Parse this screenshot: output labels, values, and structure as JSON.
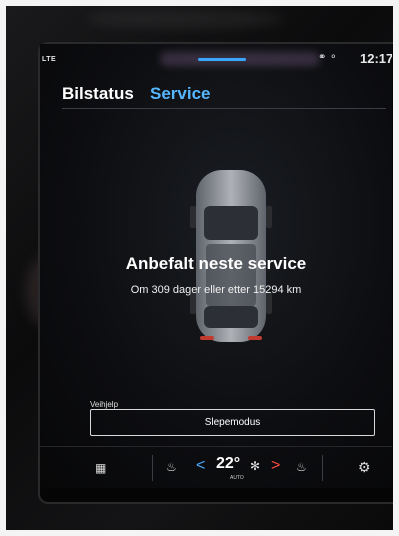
{
  "statusbar": {
    "network": "LTE",
    "icons_text": "⚭ ⚬",
    "time": "12:17"
  },
  "tabs": [
    {
      "label": "Bilstatus"
    },
    {
      "label": "Service"
    }
  ],
  "service": {
    "headline": "Anbefalt neste service",
    "detail": "Om 309 dager eller etter 15294 km"
  },
  "assistance": {
    "section_label": "Veihjelp",
    "tow_button": "Slepemodus"
  },
  "climate": {
    "temperature": "22°",
    "mode": "AUTO",
    "left_arrow": "<",
    "right_arrow": ">"
  },
  "icons": [
    "grid-icon",
    "heated-seat-left-icon",
    "fan-icon",
    "heated-seat-right-icon",
    "settings-gear-icon",
    "car-top-view"
  ],
  "colors": {
    "active_tab": "#56b7ff",
    "climate_down": "#4aa8ff",
    "climate_up": "#ff4a3a"
  }
}
